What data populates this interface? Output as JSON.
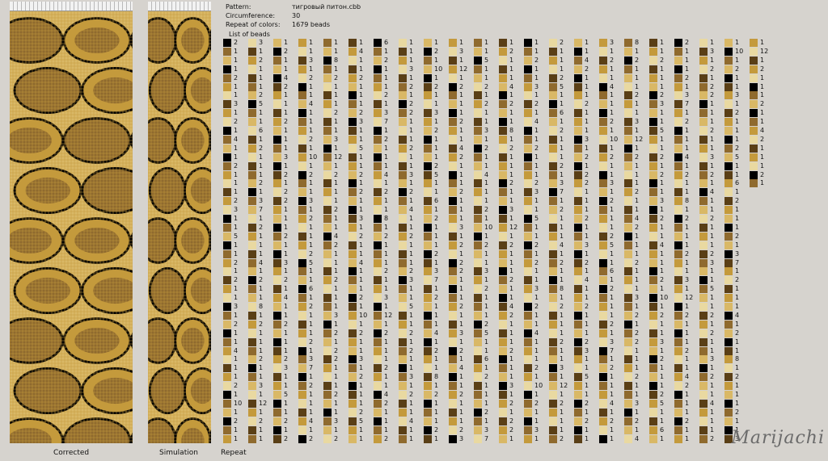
{
  "header": {
    "pattern_label": "Pattern:",
    "pattern_value": "тигровый питон.cbb",
    "circumference_label": "Circumference:",
    "circumference_value": "30",
    "repeat_label": "Repeat of colors:",
    "repeat_value": "1679 beads",
    "list_label": "List of beads"
  },
  "captions": {
    "corrected": "Corrected",
    "simulation": "Simulation",
    "repeat": "Repeat"
  },
  "signature": "Marijachi",
  "colors": {
    "black": "#000000",
    "cream": "#e9d9a1",
    "light_tan": "#d9b866",
    "gold": "#c49a3c",
    "brown": "#8f6a2e",
    "dark_brown": "#5a3f16"
  },
  "bead_list": {
    "columns": 22,
    "rows": 46,
    "palette": [
      "#000000",
      "#e9d9a1",
      "#d9b866",
      "#c49a3c",
      "#8f6a2e",
      "#5a3f16"
    ],
    "counts": [
      2,
      1,
      1,
      1,
      2,
      1,
      1,
      3,
      1,
      2,
      1,
      4,
      1,
      1,
      2,
      1,
      1,
      1,
      2,
      3,
      1,
      1,
      5,
      1,
      1,
      2,
      1,
      2,
      1,
      1,
      3,
      1,
      2,
      1,
      1,
      4,
      1,
      1,
      1,
      2,
      1,
      10,
      1,
      2,
      1,
      1,
      3,
      1,
      2,
      1,
      1,
      1,
      2,
      5,
      1,
      1,
      6,
      1,
      2,
      1,
      1,
      1,
      2,
      1,
      3,
      7,
      1,
      2,
      1,
      1,
      1,
      4,
      1,
      2,
      1,
      1,
      8,
      1,
      2,
      1,
      1,
      1,
      2,
      1,
      1,
      3,
      1,
      12,
      1,
      2,
      1,
      1,
      1,
      2,
      1,
      1,
      4,
      2,
      1,
      1,
      1,
      2,
      1,
      1,
      1,
      3,
      1,
      2,
      1,
      2
    ],
    "last_column_rows": 17
  }
}
